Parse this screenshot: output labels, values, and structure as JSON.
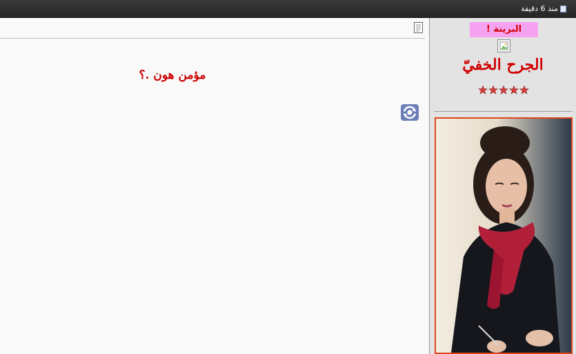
{
  "topbar": {
    "post_time": "منذ 6 دقيقة",
    "icon": "post-icon"
  },
  "post": {
    "message": "مؤمن هون .؟",
    "doc_icon": "document-icon",
    "refresh_icon": "refresh-icon"
  },
  "profile": {
    "rank": "البرينة !",
    "username": "الجرح الخفيّ",
    "rating_stars": 5,
    "avatar_icon": "broken-image-icon",
    "portrait": "member-portrait"
  },
  "colors": {
    "accent": "#cc0000",
    "rank_bg": "#f5a3f0",
    "frame": "#e0451a"
  }
}
